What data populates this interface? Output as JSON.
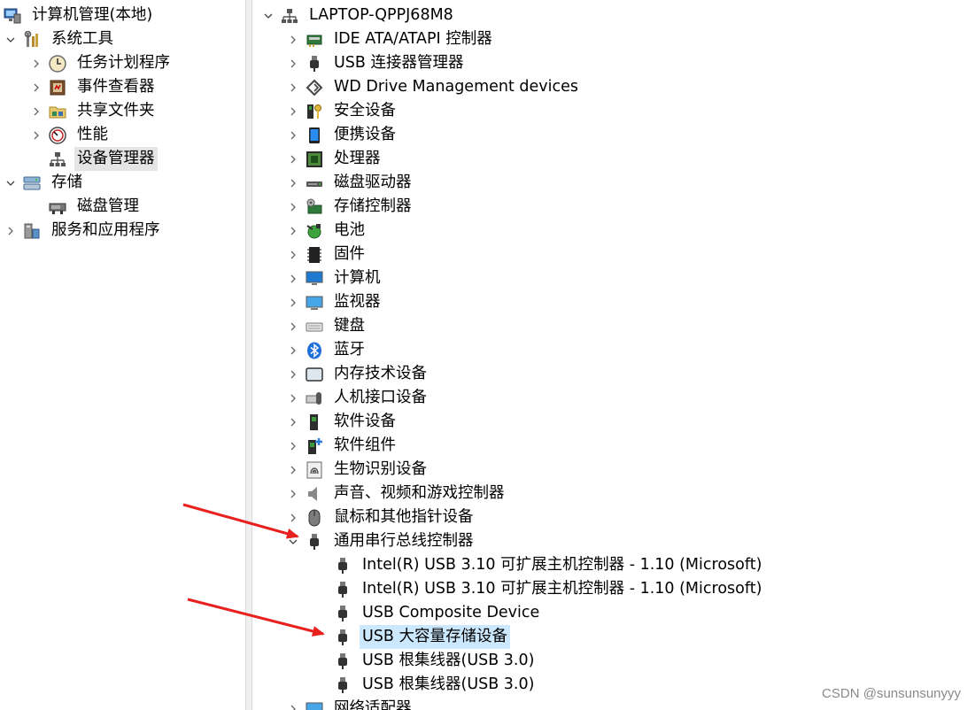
{
  "left_tree": {
    "root": "计算机管理(本地)",
    "system_tools": "系统工具",
    "task_scheduler": "任务计划程序",
    "event_viewer": "事件查看器",
    "shared_folders": "共享文件夹",
    "performance": "性能",
    "device_manager": "设备管理器",
    "storage": "存储",
    "disk_management": "磁盘管理",
    "services_apps": "服务和应用程序"
  },
  "right_tree": {
    "computer_name": "LAPTOP-QPPJ68M8",
    "categories": [
      "IDE ATA/ATAPI 控制器",
      "USB 连接器管理器",
      "WD Drive Management devices",
      "安全设备",
      "便携设备",
      "处理器",
      "磁盘驱动器",
      "存储控制器",
      "电池",
      "固件",
      "计算机",
      "监视器",
      "键盘",
      "蓝牙",
      "内存技术设备",
      "人机接口设备",
      "软件设备",
      "软件组件",
      "生物识别设备",
      "声音、视频和游戏控制器",
      "鼠标和其他指针设备",
      "通用串行总线控制器"
    ],
    "usb_children": [
      "Intel(R) USB 3.10 可扩展主机控制器 - 1.10 (Microsoft)",
      "Intel(R) USB 3.10 可扩展主机控制器 - 1.10 (Microsoft)",
      "USB Composite Device",
      "USB 大容量存储设备",
      "USB 根集线器(USB 3.0)",
      "USB 根集线器(USB 3.0)"
    ],
    "network_adapters": "网络适配器"
  },
  "watermark": "CSDN @sunsunsunyyy",
  "colors": {
    "selection_gray": "#e5e5e5",
    "selection_blue": "#cce8ff",
    "arrow_red": "#e8201e"
  }
}
